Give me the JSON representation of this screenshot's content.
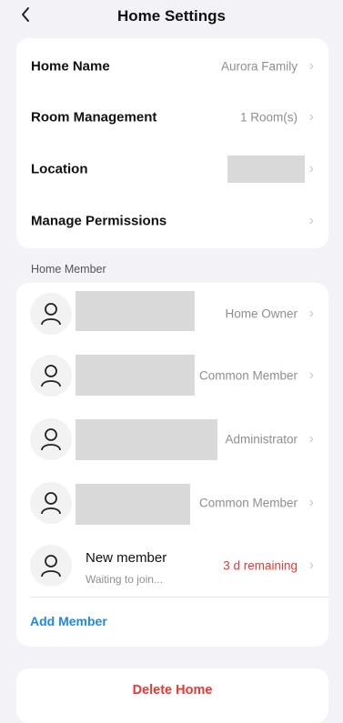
{
  "header": {
    "title": "Home Settings",
    "back_icon": "chevron-left-icon"
  },
  "settings": {
    "home_name": {
      "label": "Home Name",
      "value": "Aurora Family"
    },
    "room_management": {
      "label": "Room Management",
      "value": "1 Room(s)"
    },
    "location": {
      "label": "Location",
      "value": ""
    },
    "manage_permissions": {
      "label": "Manage Permissions"
    }
  },
  "members_section": {
    "label": "Home Member",
    "members": [
      {
        "name": "",
        "role": "Home Owner"
      },
      {
        "name": "",
        "role": "Common Member"
      },
      {
        "name": "",
        "role": "Administrator"
      },
      {
        "name": "",
        "role": "Common Member"
      },
      {
        "name": "New member",
        "subtitle": "Waiting to join...",
        "role": "3 d remaining"
      }
    ],
    "add_label": "Add Member"
  },
  "danger": {
    "delete_label": "Delete Home"
  },
  "colors": {
    "accent_blue": "#1e88e5",
    "danger_red": "#e53935",
    "background": "#f2f2f7"
  }
}
